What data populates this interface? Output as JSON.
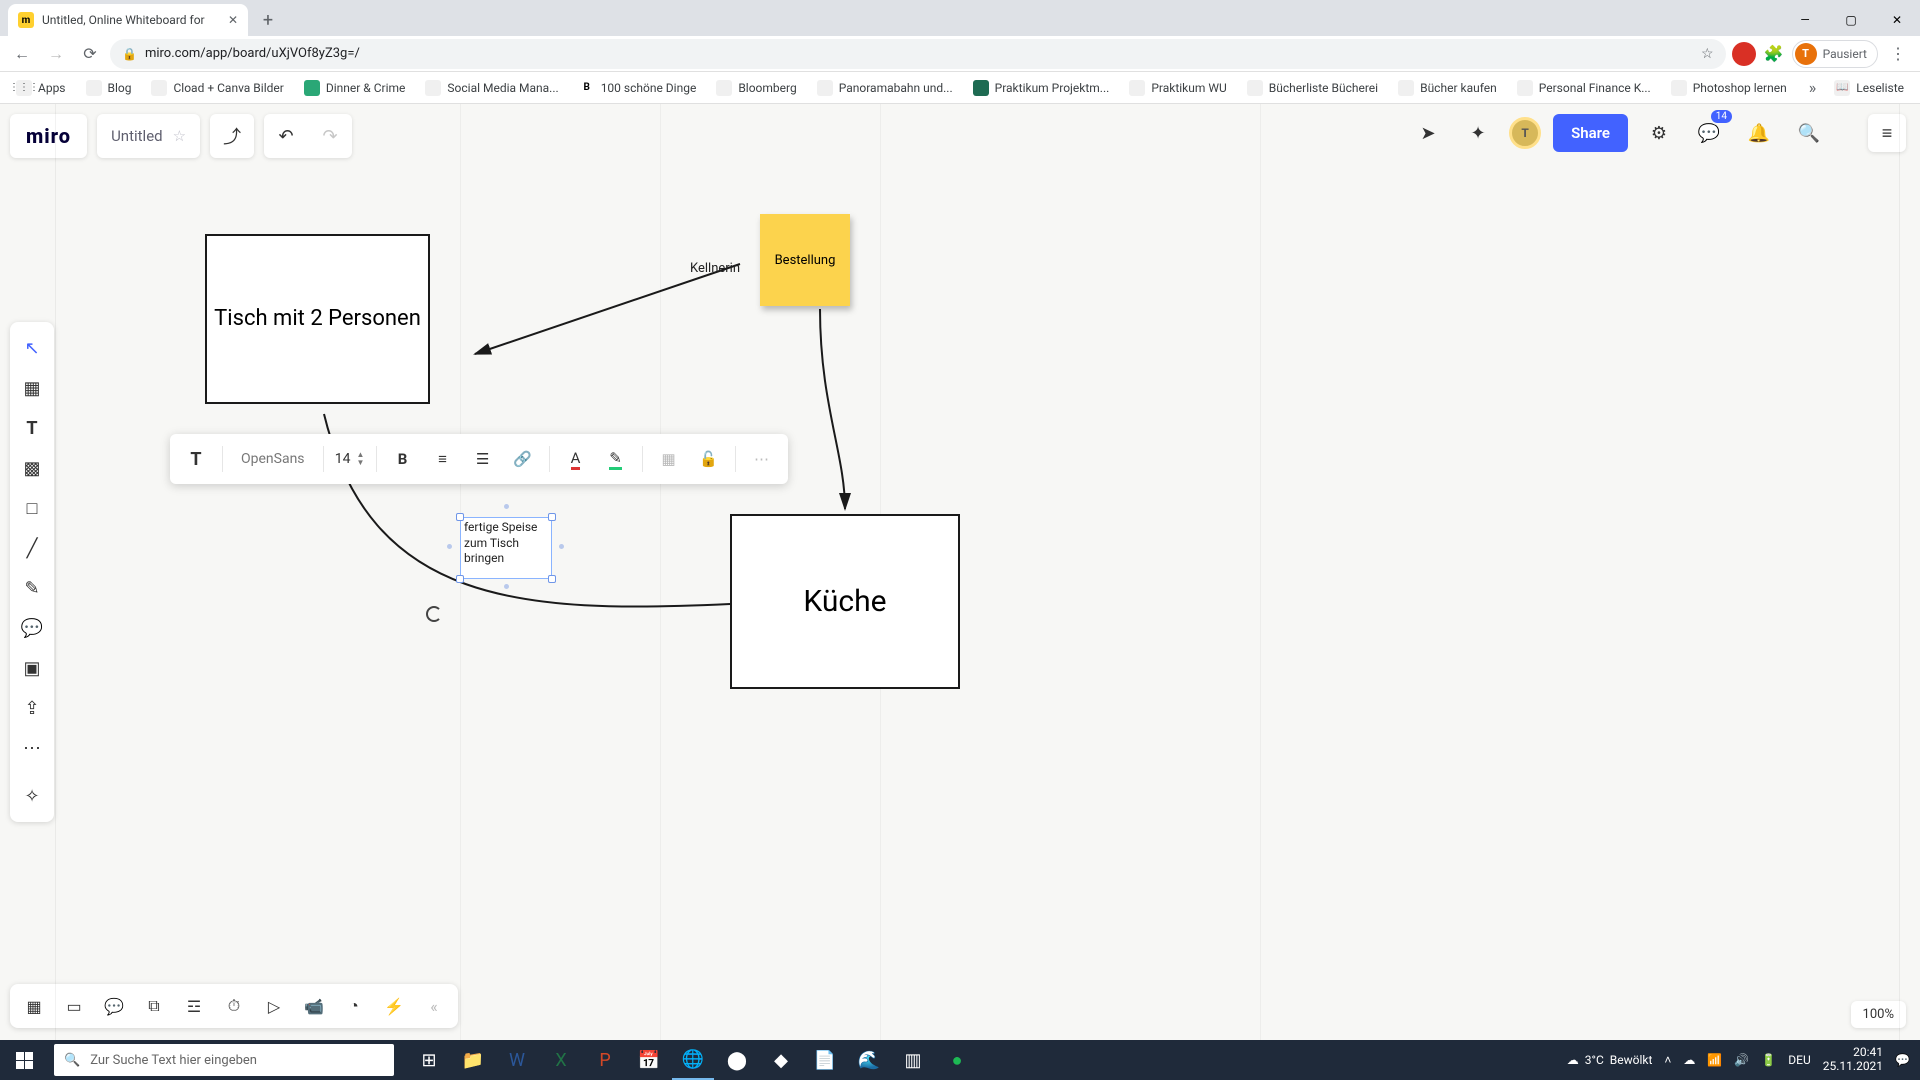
{
  "browser": {
    "tab_title": "Untitled, Online Whiteboard for",
    "url": "miro.com/app/board/uXjVOf8yZ3g=/",
    "profile_status": "Pausiert",
    "profile_initial": "T",
    "apps_label": "Apps",
    "bookmarks": [
      "Blog",
      "Cload + Canva Bilder",
      "Dinner & Crime",
      "Social Media Mana...",
      "100 schöne Dinge",
      "Bloomberg",
      "Panoramabahn und...",
      "Praktikum Projektm...",
      "Praktikum WU",
      "Bücherliste Bücherei",
      "Bücher kaufen",
      "Personal Finance K...",
      "Photoshop lernen"
    ],
    "overflow_label": "Leseliste"
  },
  "miro": {
    "logo": "miro",
    "board_title": "Untitled",
    "share": "Share",
    "notif_count": "14",
    "zoom": "100%",
    "text_toolbar": {
      "font": "OpenSans",
      "size": "14"
    },
    "nodes": {
      "tisch": "Tisch mit 2 Personen",
      "kueche": "Küche",
      "kellnerin": "Kellnerin",
      "bestellung": "Bestellung",
      "speise": "fertige Speise zum Tisch bringen"
    },
    "presence_initial": "T"
  },
  "taskbar": {
    "search_placeholder": "Zur Suche Text hier eingeben",
    "weather_temp": "3°C",
    "weather_desc": "Bewölkt",
    "lang": "DEU",
    "time": "20:41",
    "date": "25.11.2021"
  }
}
